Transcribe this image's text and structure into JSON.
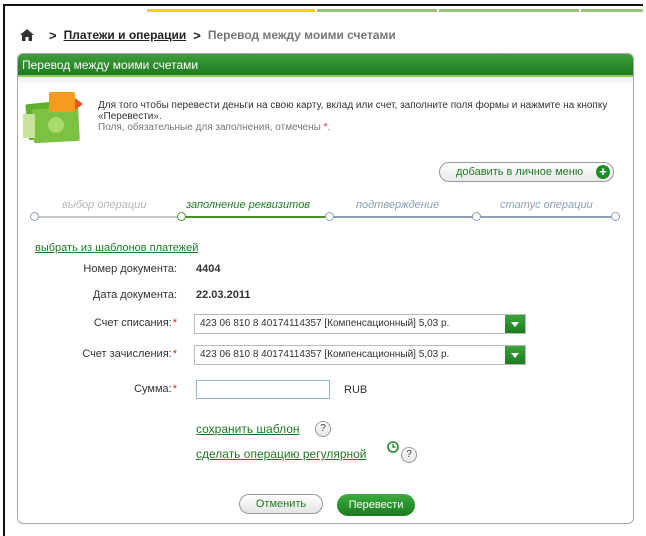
{
  "breadcrumb": {
    "home_icon": "home-icon",
    "separator": ">",
    "parent": "Платежи и операции",
    "current": "Перевод между моими счетами"
  },
  "panel": {
    "title": "Перевод между моими счетами"
  },
  "intro": {
    "icon": "money-transfer-icon",
    "text": "Для того чтобы перевести деньги на свою карту, вклад или счет, заполните поля формы и нажмите на кнопку «Перевести».",
    "note": "Поля, обязательные для заполнения, отмечены",
    "req_mark": "*",
    "note_end": "."
  },
  "add_menu": {
    "label": "добавить в личное меню",
    "icon": "plus-icon"
  },
  "steps": [
    {
      "label": "выбор операции",
      "state": "done"
    },
    {
      "label": "заполнение реквизитов",
      "state": "active"
    },
    {
      "label": "подтверждение",
      "state": "pending"
    },
    {
      "label": "статус операции",
      "state": "pending"
    }
  ],
  "templates_link": "выбрать из шаблонов платежей",
  "form": {
    "doc_number_label": "Номер документа:",
    "doc_number": "4404",
    "doc_date_label": "Дата документа:",
    "doc_date": "22.03.2011",
    "from_label": "Счет списания:",
    "from_value": "423 06 810 8 40174114357  [Компенсационный] 5,03  р.",
    "to_label": "Счет зачисления:",
    "to_value": "423 06 810 8 40174114357  [Компенсационный] 5,03  р.",
    "amount_label": "Сумма:",
    "amount_value": "",
    "currency": "RUB",
    "req_mark": "*"
  },
  "actions": {
    "save_template": "сохранить шаблон",
    "make_regular": "сделать операцию регулярной",
    "help": "?",
    "cancel": "Отменить",
    "submit": "Перевести"
  },
  "colors": {
    "accent_green": "#1e7a22",
    "header_green": "#3f9e3a",
    "required_red": "#e31e24",
    "top_yellow": "#f5d300"
  }
}
